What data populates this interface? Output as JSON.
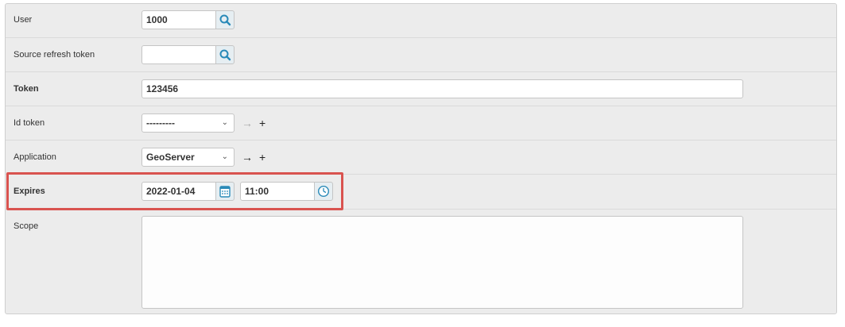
{
  "form": {
    "user": {
      "label": "User",
      "value": "1000",
      "lookup_icon": "search-icon"
    },
    "source_refresh_token": {
      "label": "Source refresh token",
      "value": "",
      "lookup_icon": "search-icon"
    },
    "token": {
      "label": "Token",
      "value": "123456"
    },
    "id_token": {
      "label": "Id token",
      "selected": "---------",
      "goto_icon": "arrow-right-icon",
      "add_icon": "plus-icon"
    },
    "application": {
      "label": "Application",
      "selected": "GeoServer",
      "goto_icon": "arrow-right-icon",
      "add_icon": "plus-icon"
    },
    "expires": {
      "label": "Expires",
      "date": "2022-01-04",
      "time": "11:00",
      "date_icon": "calendar-icon",
      "time_icon": "clock-icon"
    },
    "scope": {
      "label": "Scope",
      "value": ""
    }
  },
  "colors": {
    "highlight": "#d9534f",
    "icon_blue": "#2a8ab8"
  }
}
